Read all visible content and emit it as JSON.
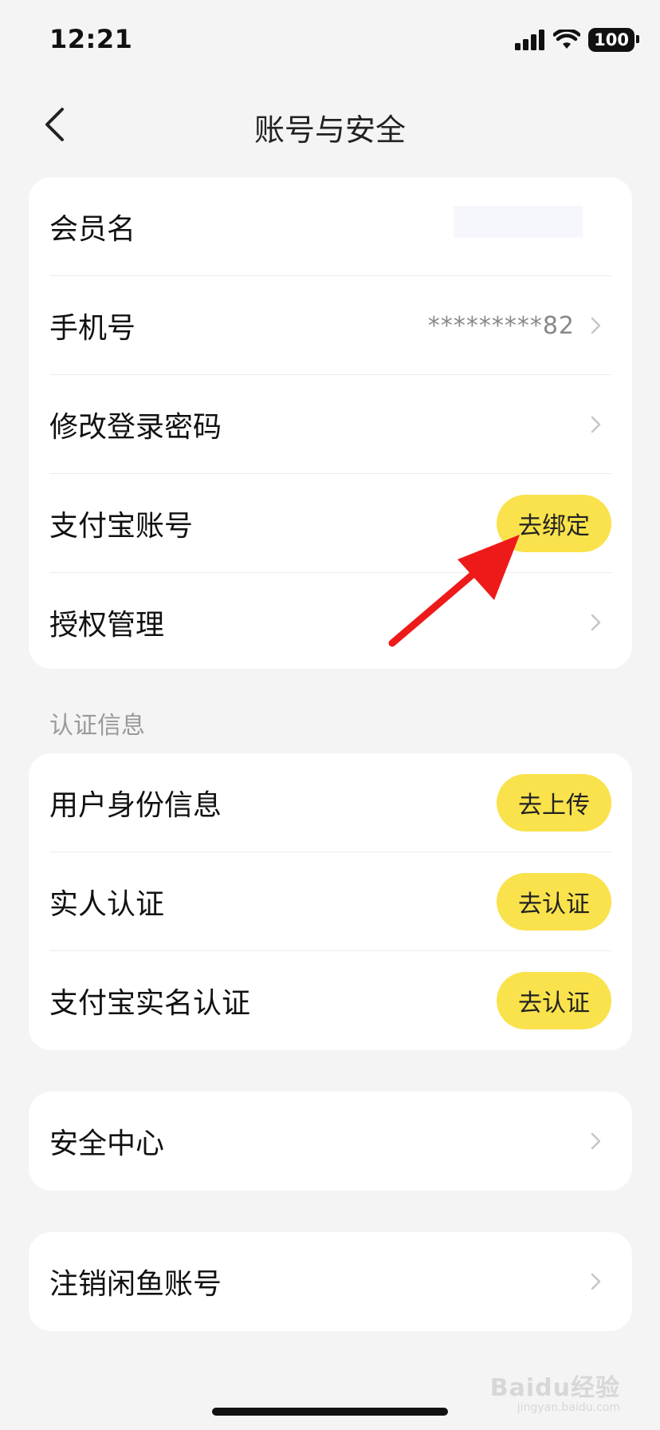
{
  "status_bar": {
    "time": "12:21",
    "battery": "100"
  },
  "nav": {
    "title": "账号与安全"
  },
  "account_card": {
    "member_name_label": "会员名",
    "phone_label": "手机号",
    "phone_value": "*********82",
    "change_password_label": "修改登录密码",
    "alipay_label": "支付宝账号",
    "alipay_button": "去绑定",
    "authorization_label": "授权管理"
  },
  "verification": {
    "section_title": "认证信息",
    "identity_label": "用户身份信息",
    "identity_button": "去上传",
    "real_person_label": "实人认证",
    "real_person_button": "去认证",
    "alipay_realname_label": "支付宝实名认证",
    "alipay_realname_button": "去认证"
  },
  "security_center": {
    "label": "安全中心"
  },
  "cancel_account": {
    "label": "注销闲鱼账号"
  },
  "watermark": {
    "brand": "Baidu经验",
    "url": "jingyan.baidu.com"
  },
  "colors": {
    "accent_yellow": "#f9e24b",
    "annotation_arrow": "#ee1a1a",
    "background": "#f4f4f4"
  }
}
